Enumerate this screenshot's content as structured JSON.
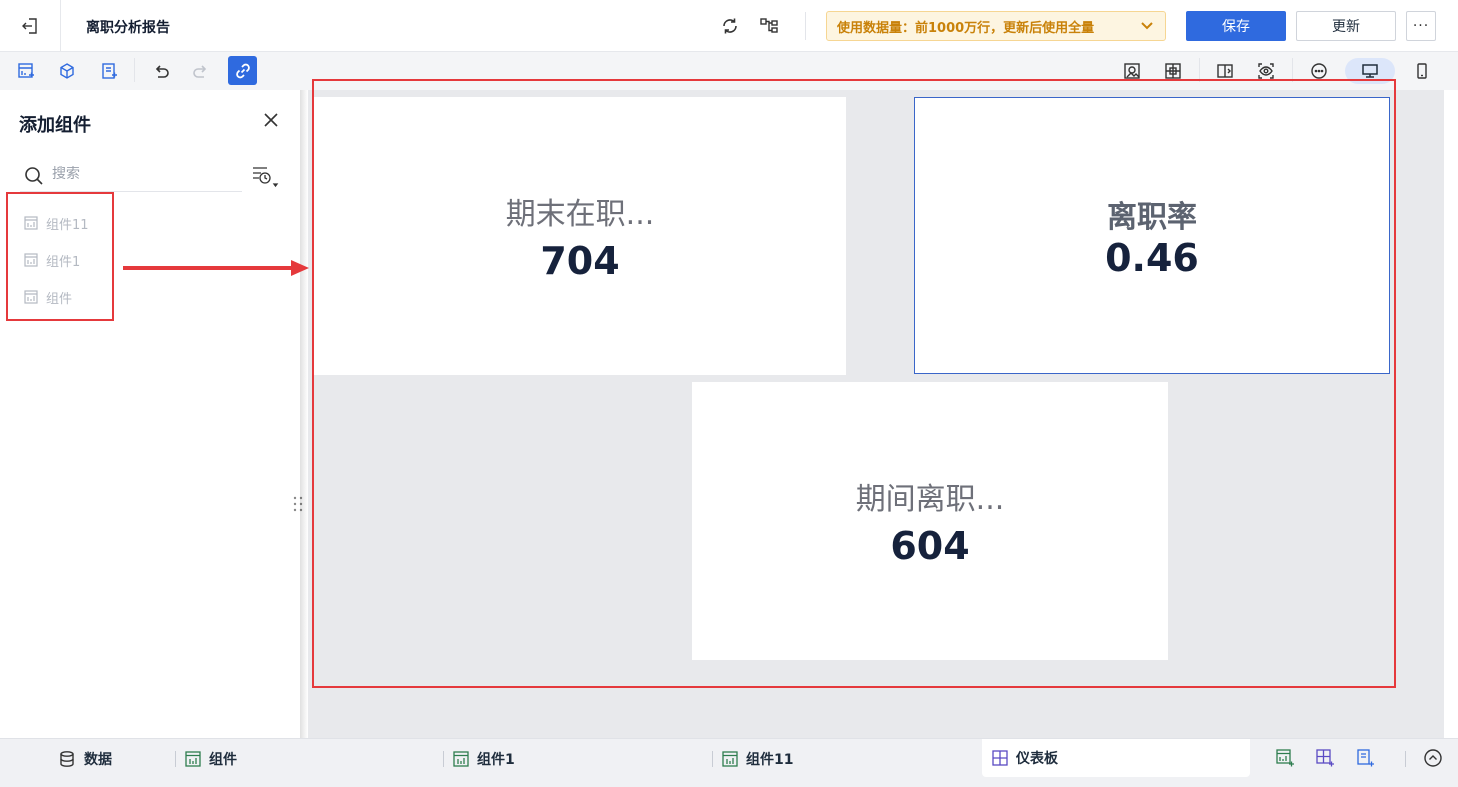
{
  "header": {
    "title": "离职分析报告",
    "data_notice": "使用数据量：前1000万行，更新后使用全量",
    "save_label": "保存",
    "update_label": "更新",
    "more_label": "···"
  },
  "panel": {
    "title": "添加组件",
    "search_placeholder": "搜索",
    "components": [
      {
        "label": "组件11"
      },
      {
        "label": "组件1"
      },
      {
        "label": "组件"
      }
    ]
  },
  "cards": [
    {
      "title": "期末在职...",
      "value": "704"
    },
    {
      "title": "离职率",
      "value": "0.46"
    },
    {
      "title": "期间离职...",
      "value": "604"
    }
  ],
  "bottom_tabs": {
    "data": "数据",
    "tab1": "组件",
    "tab2": "组件1",
    "tab3": "组件11",
    "dashboard": "仪表板"
  },
  "colors": {
    "accent": "#2f6adf",
    "highlight": "#e5393c",
    "notice_text": "#c9820a"
  }
}
